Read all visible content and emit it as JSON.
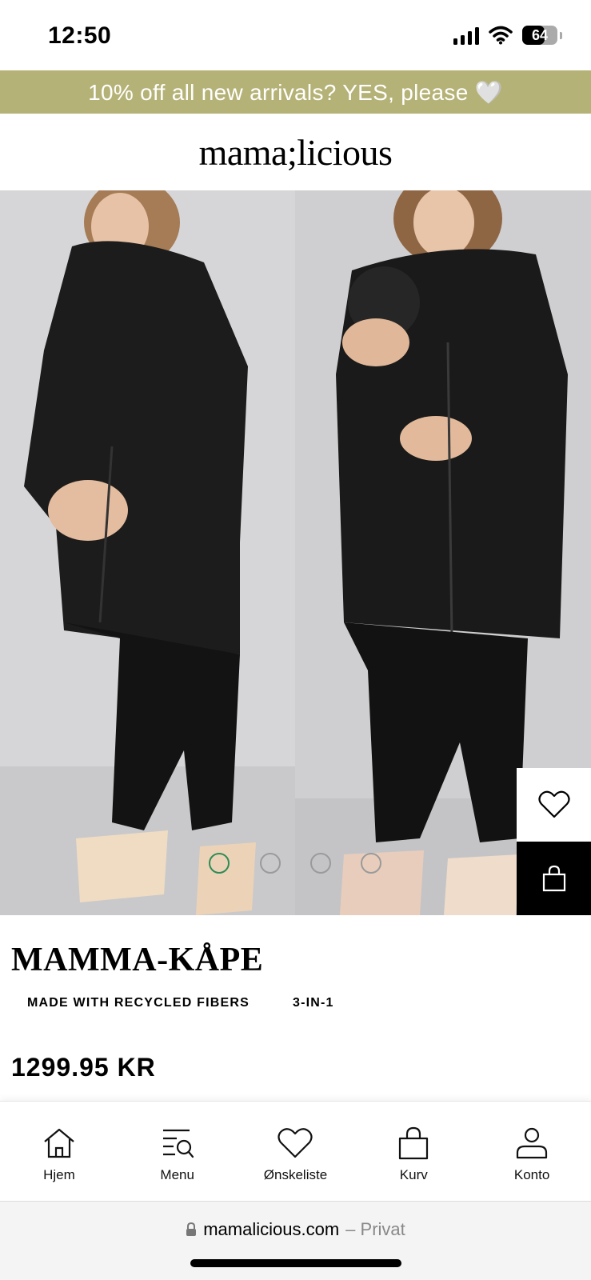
{
  "status_bar": {
    "time": "12:50",
    "battery": "64",
    "battery_level": 0.64
  },
  "promo": {
    "text": "10% off all new arrivals? YES, please 🤍"
  },
  "brand": {
    "name": "mama;licious"
  },
  "gallery": {
    "slide_count": 4,
    "active_slide": 0
  },
  "product": {
    "title": "MAMMA-KÅPE",
    "tags": [
      "MADE WITH RECYCLED FIBERS",
      "3-IN-1"
    ],
    "price": "1299.95 KR"
  },
  "actions": {
    "wishlist_icon": "heart-icon",
    "cart_icon": "bag-icon"
  },
  "bottom_nav": {
    "items": [
      {
        "label": "Hjem",
        "icon": "home-icon"
      },
      {
        "label": "Menu",
        "icon": "menu-search-icon"
      },
      {
        "label": "Ønskeliste",
        "icon": "heart-icon"
      },
      {
        "label": "Kurv",
        "icon": "bag-icon"
      },
      {
        "label": "Konto",
        "icon": "user-icon"
      }
    ]
  },
  "browser": {
    "domain": "mamalicious.com",
    "mode": "– Privat"
  },
  "colors": {
    "promo_bg": "#b5b277",
    "active_dot": "#2e8b57"
  }
}
